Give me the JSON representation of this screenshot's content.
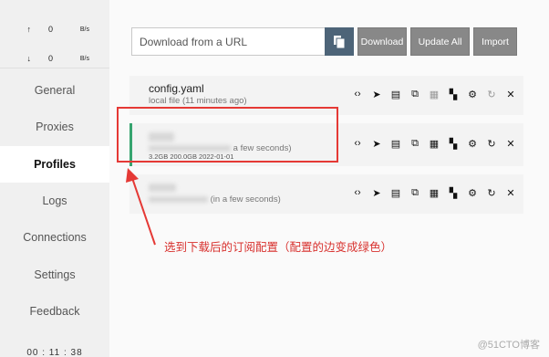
{
  "window": {
    "pin": "⯅",
    "minimize": "—",
    "maximize": "☐",
    "close": "✕"
  },
  "traffic": {
    "up": {
      "arrow": "↑",
      "value": "0",
      "unit": "B/s"
    },
    "down": {
      "arrow": "↓",
      "value": "0",
      "unit": "B/s"
    }
  },
  "sidebar": {
    "items": [
      {
        "label": "General"
      },
      {
        "label": "Proxies"
      },
      {
        "label": "Profiles"
      },
      {
        "label": "Logs"
      },
      {
        "label": "Connections"
      },
      {
        "label": "Settings"
      },
      {
        "label": "Feedback"
      }
    ],
    "active": "Profiles",
    "clock": "00 : 11 : 38"
  },
  "toolbar": {
    "url_placeholder": "Download from a URL",
    "download_label": "Download",
    "update_all_label": "Update All",
    "import_label": "Import"
  },
  "profiles": [
    {
      "title": "config.yaml",
      "sub": "local file (11 minutes ago)",
      "stats": "",
      "selected": false
    },
    {
      "title": "",
      "sub": "a few seconds)",
      "stats": "3.2GB   200.0GB   2022-01-01",
      "selected": true
    },
    {
      "title": "",
      "sub": "(in a few seconds)",
      "stats": "",
      "selected": false
    }
  ],
  "annotation": {
    "text": "选到下载后的订阅配置（配置的边变成绿色）",
    "color": "#e53935"
  },
  "watermark": "@51CTO博客",
  "colors": {
    "accent": "#36a46f",
    "paste_button": "#4d6478",
    "button": "#888888"
  }
}
